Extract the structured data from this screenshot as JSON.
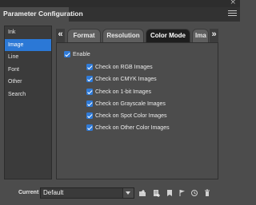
{
  "window": {
    "close_glyph": "×",
    "title": "Parameter Configuration"
  },
  "sidebar": {
    "items": [
      {
        "label": "Ink",
        "active": false
      },
      {
        "label": "Image",
        "active": true
      },
      {
        "label": "Line",
        "active": false
      },
      {
        "label": "Font",
        "active": false
      },
      {
        "label": "Other",
        "active": false
      },
      {
        "label": "Search",
        "active": false
      }
    ]
  },
  "tabs": {
    "prev_glyph": "«",
    "next_glyph": "»",
    "items": [
      {
        "label": "Format",
        "active": false
      },
      {
        "label": "Resolution",
        "active": false
      },
      {
        "label": "Color Mode",
        "active": true
      },
      {
        "label": "Ima",
        "active": false
      }
    ]
  },
  "options": {
    "enable": {
      "label": "Enable",
      "checked": true
    },
    "checks": [
      {
        "label": "Check on RGB Images",
        "checked": true
      },
      {
        "label": "Check on CMYK Images",
        "checked": true
      },
      {
        "label": "Check on 1-bit Images",
        "checked": true
      },
      {
        "label": "Check on Grayscale Images",
        "checked": true
      },
      {
        "label": "Check on Spot Color Images",
        "checked": true
      },
      {
        "label": "Check on Other Color Images",
        "checked": true
      }
    ]
  },
  "footer": {
    "current_set_label": "Current Set:",
    "current_set_value": "Default",
    "icons": [
      "new-folder-icon",
      "new-set-icon",
      "save-set-icon",
      "set-flag-icon",
      "history-icon",
      "delete-icon"
    ]
  },
  "colors": {
    "accent": "#2b78d6",
    "background": "#4c4c4c",
    "active_tab": "#1e1e1e"
  }
}
